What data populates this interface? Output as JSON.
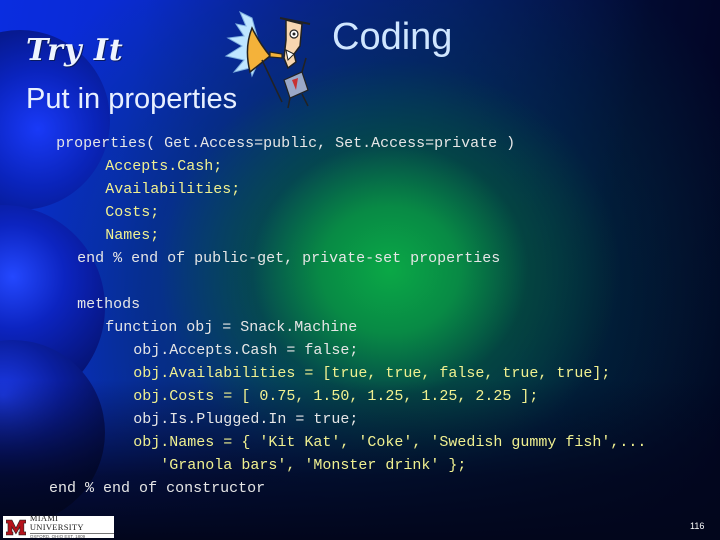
{
  "slide": {
    "section_label": "Try It",
    "title": "Coding",
    "subtitle": "Put in properties",
    "page_number": "116"
  },
  "code_lines": [
    {
      "indent": 4,
      "color": "white",
      "text": "properties( Get.Access=public, Set.Access=private )"
    },
    {
      "indent": 11,
      "color": "yellow",
      "text": "Accepts.Cash;"
    },
    {
      "indent": 11,
      "color": "yellow",
      "text": "Availabilities;"
    },
    {
      "indent": 11,
      "color": "yellow",
      "text": "Costs;"
    },
    {
      "indent": 11,
      "color": "yellow",
      "text": "Names;"
    },
    {
      "indent": 7,
      "color": "white",
      "text": "end % end of public-get, private-set properties"
    },
    {
      "indent": 0,
      "color": "white",
      "text": ""
    },
    {
      "indent": 7,
      "color": "white",
      "text": "methods"
    },
    {
      "indent": 11,
      "color": "white",
      "text": "function obj = Snack.Machine"
    },
    {
      "indent": 15,
      "color": "white",
      "text": "obj.Accepts.Cash = false;"
    },
    {
      "indent": 15,
      "color": "yellow",
      "text": "obj.Availabilities = [true, true, false, true, true];"
    },
    {
      "indent": 15,
      "color": "yellow",
      "text": "obj.Costs = [ 0.75, 1.50, 1.25, 1.25, 2.25 ];"
    },
    {
      "indent": 15,
      "color": "white",
      "text": "obj.Is.Plugged.In = true;"
    },
    {
      "indent": 15,
      "color": "yellow",
      "text": "obj.Names = { 'Kit Kat', 'Coke', 'Swedish gummy fish',..."
    },
    {
      "indent": 15,
      "color": "yellow",
      "text": "   'Granola bars', 'Monster drink' };"
    },
    {
      "indent": 3,
      "color": "white",
      "text": "end % end of constructor"
    }
  ],
  "footer": {
    "logo_name": "MIAMI UNIVERSITY",
    "logo_location": "OXFORD, OHIO  EST. 1809"
  },
  "colors": {
    "code_white": "#e6e6e6",
    "code_yellow": "#f0f090",
    "title": "#cfe6ff",
    "miami_red": "#b5121b"
  }
}
